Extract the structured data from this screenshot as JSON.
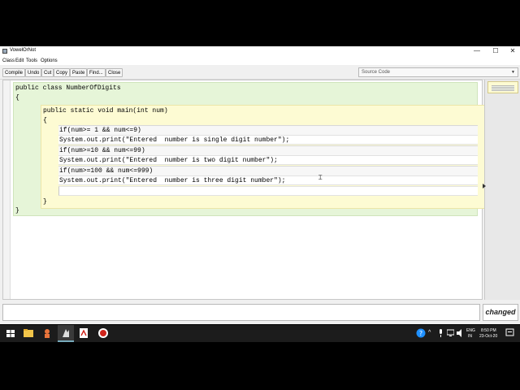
{
  "window": {
    "title": "VowelOrNot",
    "controls": {
      "minimize": "—",
      "maximize": "☐",
      "close": "✕"
    }
  },
  "menu": {
    "items": [
      "Class",
      "Edit",
      "Tools",
      "Options"
    ]
  },
  "toolbar": {
    "buttons": [
      "Compile",
      "Undo",
      "Cut",
      "Copy",
      "Paste",
      "Find...",
      "Close"
    ],
    "view_select": "Source Code"
  },
  "code": {
    "class_decl": "public class NumberOfDigits",
    "class_open": "{",
    "method_decl": "public static void main(int num)",
    "method_open": "{",
    "lines": [
      "if(num>= 1 && num<=9)",
      "System.out.print(\"Entered  number is single digit number\");",
      "if(num>=10 && num<=99)",
      "System.out.print(\"Entered  number is two digit number\");",
      "if(num>=100 && num<=999)",
      "System.out.print(\"Entered  number is three digit number\");",
      ""
    ],
    "method_close": "}",
    "class_close": "}"
  },
  "status": {
    "message": "",
    "changed": "changed"
  },
  "taskbar": {
    "language": "ENG",
    "region": "IN",
    "time": "8:50 PM",
    "date": "23-Oct-20"
  }
}
